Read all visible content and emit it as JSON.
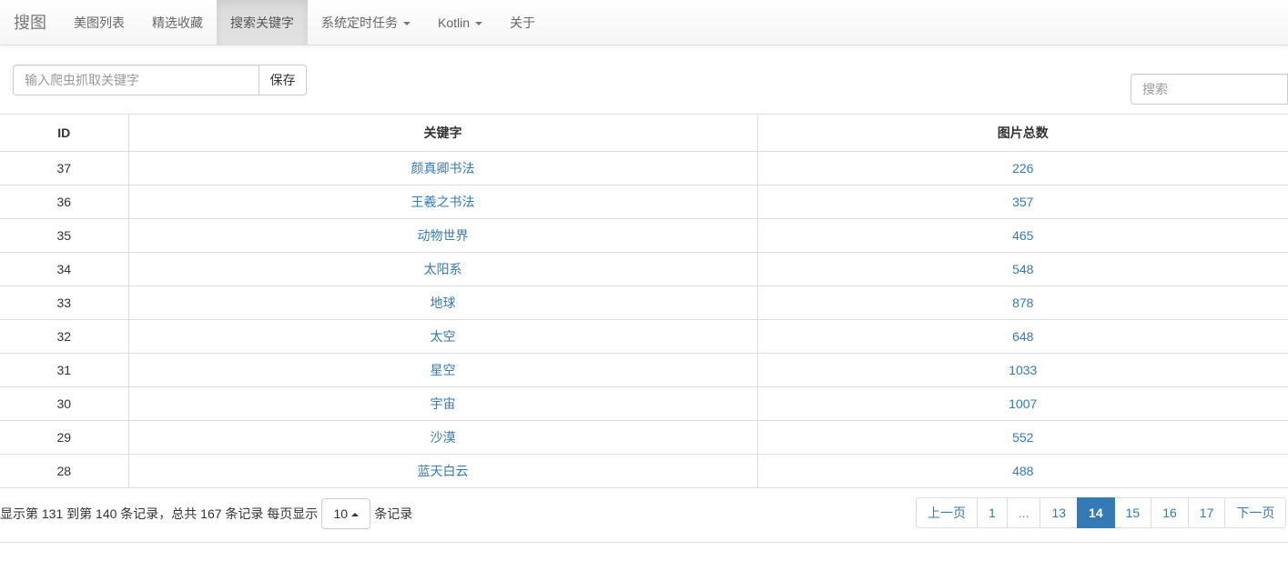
{
  "navbar": {
    "brand": "搜图",
    "items": [
      {
        "label": "美图列表"
      },
      {
        "label": "精选收藏"
      },
      {
        "label": "搜索关键字"
      },
      {
        "label": "系统定时任务"
      },
      {
        "label": "Kotlin"
      },
      {
        "label": "关于"
      }
    ]
  },
  "toolbar": {
    "keyword_placeholder": "输入爬虫抓取关键字",
    "save_label": "保存",
    "search_placeholder": "搜索"
  },
  "table": {
    "headers": [
      "ID",
      "关键字",
      "图片总数"
    ],
    "rows": [
      {
        "id": "37",
        "keyword": "颜真卿书法",
        "count": "226"
      },
      {
        "id": "36",
        "keyword": "王羲之书法",
        "count": "357"
      },
      {
        "id": "35",
        "keyword": "动物世界",
        "count": "465"
      },
      {
        "id": "34",
        "keyword": "太阳系",
        "count": "548"
      },
      {
        "id": "33",
        "keyword": "地球",
        "count": "878"
      },
      {
        "id": "32",
        "keyword": "太空",
        "count": "648"
      },
      {
        "id": "31",
        "keyword": "星空",
        "count": "1033"
      },
      {
        "id": "30",
        "keyword": "宇宙",
        "count": "1007"
      },
      {
        "id": "29",
        "keyword": "沙漠",
        "count": "552"
      },
      {
        "id": "28",
        "keyword": "蓝天白云",
        "count": "488"
      }
    ]
  },
  "footer": {
    "info_prefix": "显示第 131 到第 140 条记录，总共 167 条记录 每页显示",
    "page_size": "10",
    "info_suffix": "条记录"
  },
  "pagination": {
    "prev": "上一页",
    "pages": [
      "1",
      "...",
      "13",
      "14",
      "15",
      "16",
      "17"
    ],
    "next": "下一页"
  }
}
